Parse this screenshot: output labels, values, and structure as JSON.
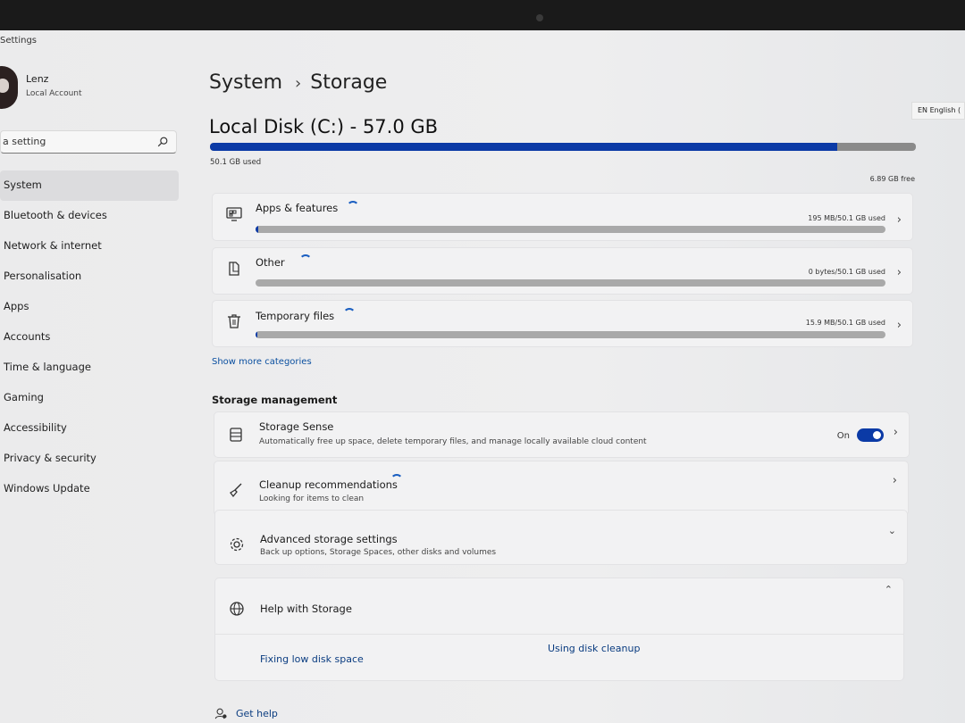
{
  "app": {
    "title": "Settings",
    "language_indicator": "EN English ("
  },
  "user": {
    "name": "Lenz",
    "account_type": "Local Account"
  },
  "search": {
    "value": "a setting"
  },
  "sidebar": {
    "items": [
      {
        "label": "System",
        "active": true
      },
      {
        "label": "Bluetooth & devices"
      },
      {
        "label": "Network & internet"
      },
      {
        "label": "Personalisation"
      },
      {
        "label": "Apps"
      },
      {
        "label": "Accounts"
      },
      {
        "label": "Time & language"
      },
      {
        "label": "Gaming"
      },
      {
        "label": "Accessibility"
      },
      {
        "label": "Privacy & security"
      },
      {
        "label": "Windows Update"
      }
    ]
  },
  "breadcrumb": {
    "parent": "System",
    "separator": "›",
    "current": "Storage"
  },
  "disk": {
    "title": "Local Disk (C:) - 57.0 GB",
    "used_label": "50.1 GB used",
    "free_label": "6.89 GB free",
    "used_fraction": 0.888
  },
  "categories": [
    {
      "name": "Apps & features",
      "size": "195 MB/50.1 GB used",
      "icon": "apps-features-icon",
      "fraction": 0.004
    },
    {
      "name": "Other",
      "size": "0 bytes/50.1 GB used",
      "icon": "other-files-icon",
      "fraction": 0
    },
    {
      "name": "Temporary files",
      "size": "15.9 MB/50.1 GB used",
      "icon": "trash-icon",
      "fraction": 0.0003
    }
  ],
  "show_more": "Show more categories",
  "management": {
    "section_title": "Storage management",
    "storage_sense": {
      "title": "Storage Sense",
      "subtitle": "Automatically free up space, delete temporary files, and manage locally available cloud content",
      "toggle_label": "On",
      "enabled": true
    },
    "cleanup": {
      "title": "Cleanup recommendations",
      "subtitle": "Looking for items to clean"
    },
    "advanced": {
      "title": "Advanced storage settings",
      "subtitle": "Back up options, Storage Spaces, other disks and volumes"
    }
  },
  "help": {
    "title": "Help with Storage",
    "links": [
      "Fixing low disk space",
      "Using disk cleanup"
    ]
  },
  "get_help": "Get help",
  "colors": {
    "accent": "#0b3aa6",
    "link": "#0a4fa0",
    "background": "#ebebec",
    "card": "#f2f2f3"
  }
}
